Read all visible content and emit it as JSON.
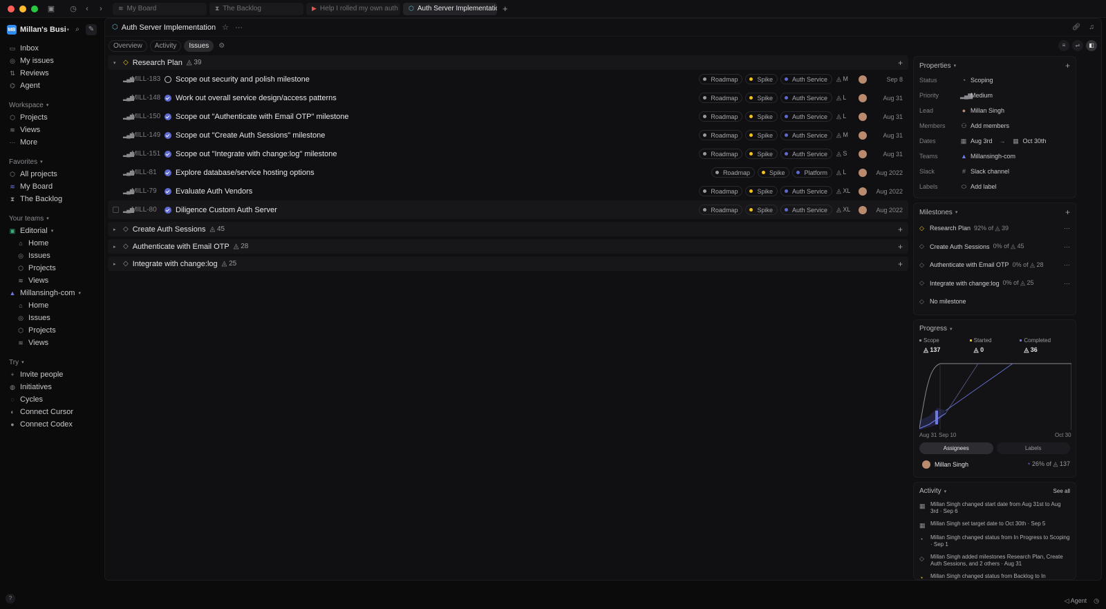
{
  "tabs": [
    {
      "label": "My Board",
      "icon": "board-icon"
    },
    {
      "label": "The Backlog",
      "icon": "hourglass-icon"
    },
    {
      "label": "Help I rolled my own auth and r",
      "icon": "video-icon"
    },
    {
      "label": "Auth Server Implementation",
      "icon": "project-icon"
    }
  ],
  "workspace": {
    "initials": "MB",
    "name": "Millan's Busine..."
  },
  "nav": {
    "top": [
      "Inbox",
      "My issues",
      "Reviews",
      "Agent"
    ],
    "workspace_label": "Workspace",
    "workspace_items": [
      "Projects",
      "Views",
      "More"
    ],
    "favorites_label": "Favorites",
    "favorites_items": [
      "All projects",
      "My Board",
      "The Backlog"
    ],
    "teams_label": "Your teams",
    "team1": {
      "name": "Editorial",
      "items": [
        "Home",
        "Issues",
        "Projects",
        "Views"
      ]
    },
    "team2": {
      "name": "Millansingh-com",
      "items": [
        "Home",
        "Issues",
        "Projects",
        "Views"
      ]
    },
    "try_label": "Try",
    "try_items": [
      "Invite people",
      "Initiatives",
      "Cycles",
      "Connect Cursor",
      "Connect Codex"
    ]
  },
  "header": {
    "title": "Auth Server Implementation"
  },
  "subtabs": [
    "Overview",
    "Activity",
    "Issues"
  ],
  "groups": [
    {
      "name": "Research Plan",
      "count": "39"
    },
    {
      "name": "Create Auth Sessions",
      "count": "45"
    },
    {
      "name": "Authenticate with Email OTP",
      "count": "28"
    },
    {
      "name": "Integrate with change:log",
      "count": "25"
    }
  ],
  "issues": [
    {
      "id": "MILL-183",
      "title": "Scope out security and polish milestone",
      "status": "scope",
      "labels": [
        "Roadmap",
        "Spike",
        "Auth Service"
      ],
      "estimate": "M",
      "date": "Sep 8"
    },
    {
      "id": "MILL-148",
      "title": "Work out overall service design/access patterns",
      "status": "done",
      "labels": [
        "Roadmap",
        "Spike",
        "Auth Service"
      ],
      "estimate": "L",
      "date": "Aug 31"
    },
    {
      "id": "MILL-150",
      "title": "Scope out \"Authenticate with Email OTP\" milestone",
      "status": "done",
      "labels": [
        "Roadmap",
        "Spike",
        "Auth Service"
      ],
      "estimate": "L",
      "date": "Aug 31"
    },
    {
      "id": "MILL-149",
      "title": "Scope out \"Create Auth Sessions\" milestone",
      "status": "done",
      "labels": [
        "Roadmap",
        "Spike",
        "Auth Service"
      ],
      "estimate": "M",
      "date": "Aug 31"
    },
    {
      "id": "MILL-151",
      "title": "Scope out \"Integrate with change:log\" milestone",
      "status": "done",
      "labels": [
        "Roadmap",
        "Spike",
        "Auth Service"
      ],
      "estimate": "S",
      "date": "Aug 31"
    },
    {
      "id": "MILL-81",
      "title": "Explore database/service hosting options",
      "status": "done",
      "labels": [
        "Roadmap",
        "Spike",
        "Platform"
      ],
      "estimate": "L",
      "date": "Aug 2022"
    },
    {
      "id": "MILL-79",
      "title": "Evaluate Auth Vendors",
      "status": "done",
      "labels": [
        "Roadmap",
        "Spike",
        "Auth Service"
      ],
      "estimate": "XL",
      "date": "Aug 2022"
    },
    {
      "id": "MILL-80",
      "title": "Diligence Custom Auth Server",
      "status": "done",
      "labels": [
        "Roadmap",
        "Spike",
        "Auth Service"
      ],
      "estimate": "XL",
      "date": "Aug 2022"
    }
  ],
  "label_colors": {
    "Roadmap": "#9a9aa0",
    "Spike": "#f2c21b",
    "Auth Service": "#5e6ad2",
    "Platform": "#5e6ad2"
  },
  "properties": {
    "title": "Properties",
    "rows": [
      {
        "key": "Status",
        "value": "Scoping",
        "icon": "scoping-icon"
      },
      {
        "key": "Priority",
        "value": "Medium",
        "icon": "priority-icon"
      },
      {
        "key": "Lead",
        "value": "Millan Singh",
        "icon": "avatar"
      },
      {
        "key": "Members",
        "value": "Add members",
        "icon": "add-member-icon"
      },
      {
        "key": "Teams",
        "value": "Millansingh-com",
        "icon": "team-icon"
      },
      {
        "key": "Slack",
        "value": "Slack channel",
        "icon": "slack-icon"
      },
      {
        "key": "Labels",
        "value": "Add label",
        "icon": "label-icon"
      }
    ],
    "dates_key": "Dates",
    "start": "Aug 3rd",
    "end": "Oct 30th"
  },
  "milestones": {
    "title": "Milestones",
    "items": [
      {
        "name": "Research Plan",
        "progress": "92% of",
        "count": "39"
      },
      {
        "name": "Create Auth Sessions",
        "progress": "0% of",
        "count": "45"
      },
      {
        "name": "Authenticate with Email OTP",
        "progress": "0% of",
        "count": "28"
      },
      {
        "name": "Integrate with change:log",
        "progress": "0% of",
        "count": "25"
      }
    ],
    "none": "No milestone"
  },
  "progress": {
    "title": "Progress",
    "scope_label": "Scope",
    "scope": "137",
    "started_label": "Started",
    "started": "0",
    "completed_label": "Completed",
    "completed": "36",
    "x_ticks": [
      "Aug 31",
      "Sep 10",
      "Oct 30"
    ],
    "seg": [
      "Assignees",
      "Labels"
    ],
    "assignee": "Millan Singh",
    "assignee_pct": "26% of",
    "assignee_total": "137"
  },
  "activity": {
    "title": "Activity",
    "see_all": "See all",
    "items": [
      "Millan Singh changed start date from Aug 31st to Aug 3rd · Sep 6",
      "Millan Singh set target date to Oct 30th · Sep 5",
      "Millan Singh changed status from In Progress to Scoping · Sep 1",
      "Millan Singh added milestones Research Plan, Create Auth Sessions, and 2 others · Aug 31",
      "Millan Singh changed status from Backlog to In"
    ]
  },
  "bottom": {
    "agent": "Agent"
  }
}
